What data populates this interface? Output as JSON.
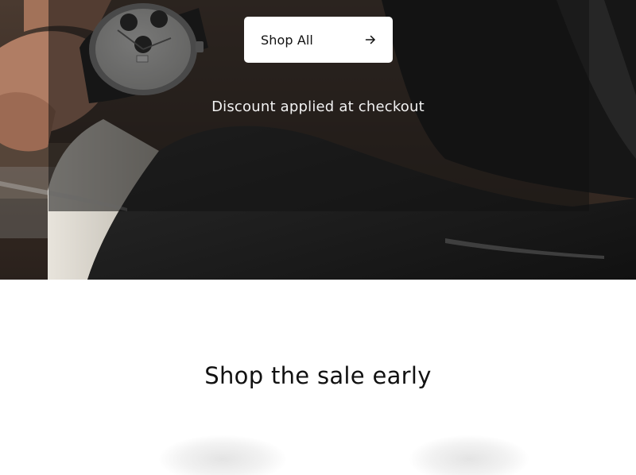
{
  "hero": {
    "cta_label": "Shop All",
    "cta_icon": "arrow-right-icon",
    "note": "Discount applied at checkout"
  },
  "sale": {
    "heading": "Shop the sale early"
  },
  "colors": {
    "overlay": "#121212",
    "cta_background": "#ffffff",
    "heading_text": "#111111"
  }
}
